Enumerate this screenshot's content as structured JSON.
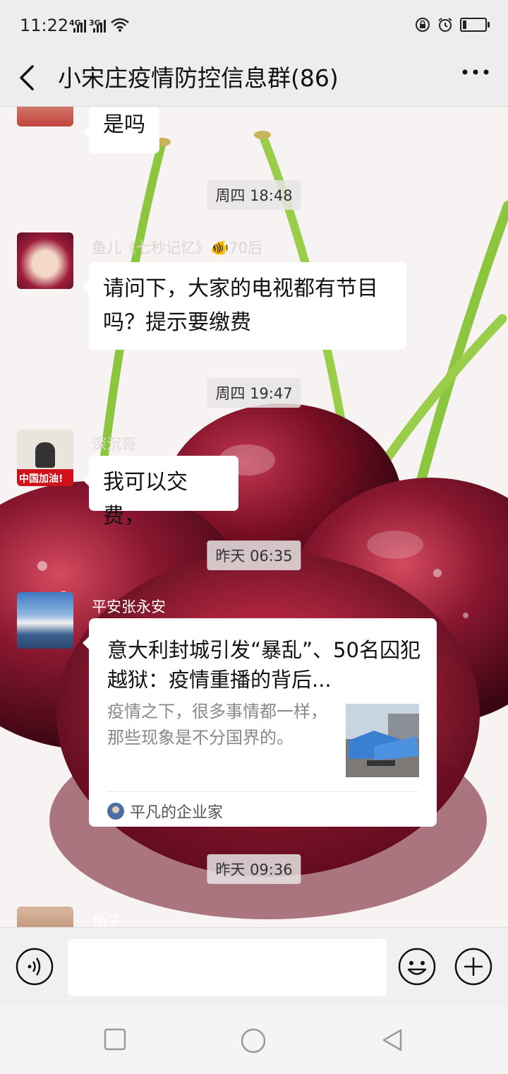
{
  "status_bar": {
    "time": "11:22",
    "net1": "4G",
    "net2": "3G"
  },
  "header": {
    "title": "小宋庄疫情防控信息群(86)"
  },
  "messages": [
    {
      "type": "text",
      "text": "是吗"
    },
    {
      "type": "time",
      "text": "周四 18:48"
    },
    {
      "type": "text",
      "sender": "鱼儿《七秒记忆》🐠70后",
      "text": "请问下，大家的电视都有节目吗？提示要缴费"
    },
    {
      "type": "time",
      "text": "周四 19:47"
    },
    {
      "type": "text",
      "sender": "深沉哥",
      "avatar_caption": "中国加油!",
      "text": "我可以交费，"
    },
    {
      "type": "time",
      "text": "昨天 06:35"
    },
    {
      "type": "card",
      "sender": "平安张永安",
      "title": "意大利封城引发“暴乱”、50名囚犯越狱：疫情重播的背后...",
      "description": "疫情之下，很多事情都一样，那些现象是不分国界的。",
      "source": "平凡的企业家"
    },
    {
      "type": "time",
      "text": "昨天 09:36"
    },
    {
      "type": "partial",
      "sender": "杨子"
    }
  ],
  "input_bar": {
    "placeholder": ""
  },
  "icons": {
    "back": "chevron-left-icon",
    "more": "more-icon",
    "voice": "voice-icon",
    "emoji": "emoji-icon",
    "plus": "plus-icon",
    "nav_recent": "square-icon",
    "nav_home": "circle-icon",
    "nav_back": "triangle-back-icon"
  },
  "colors": {
    "header_bg": "#ededed",
    "bubble": "#ffffff",
    "sender": "#6f6f6f",
    "cherry": "#7a0f24",
    "stem": "#8cc63f"
  }
}
